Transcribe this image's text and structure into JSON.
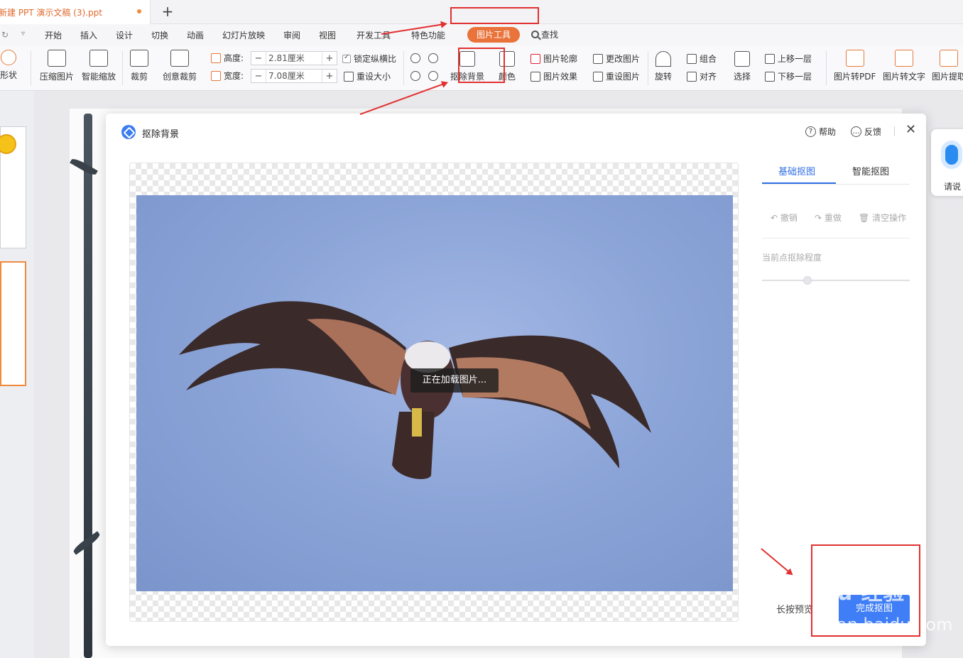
{
  "window": {
    "doc_tab_title": "新建 PPT 演示文稿 (3).ppt",
    "new_tab_symbol": "+"
  },
  "menubar": {
    "undo_symbol": "↻",
    "undo_more": "▿",
    "items": [
      "开始",
      "插入",
      "设计",
      "切换",
      "动画",
      "幻灯片放映",
      "审阅",
      "视图",
      "开发工具",
      "特色功能"
    ],
    "active_tab": "图片工具",
    "search_label": "查找"
  },
  "ribbon": {
    "shape_label": "形状",
    "compress_label": "压缩图片",
    "smart_zoom_label": "智能缩放",
    "crop_label": "裁剪",
    "creative_crop_label": "创意裁剪",
    "height_label": "高度:",
    "width_label": "宽度:",
    "height_value": "2.81厘米",
    "width_value": "7.08厘米",
    "lock_ratio_label": "锁定纵横比",
    "reset_size_label": "重设大小",
    "remove_bg_label": "抠除背景",
    "color_label": "颜色",
    "outline_label": "图片轮廓",
    "change_picture_label": "更改图片",
    "effects_label": "图片效果",
    "reset_picture_label": "重设图片",
    "rotate_label": "旋转",
    "group_label": "组合",
    "align_label": "对齐",
    "select_label": "选择",
    "bring_forward_label": "上移一层",
    "send_backward_label": "下移一层",
    "to_pdf_label": "图片转PDF",
    "to_text_label": "图片转文字",
    "extract_label": "图片提取"
  },
  "dialog": {
    "title": "抠除背景",
    "help_label": "帮助",
    "feedback_label": "反馈",
    "close_symbol": "✕",
    "loading_text": "正在加载图片...",
    "tabs": [
      "基础抠图",
      "智能抠图"
    ],
    "undo_label": "撤销",
    "redo_label": "重做",
    "clear_label": "清空操作",
    "degree_label": "当前点抠除程度",
    "degree_value": 0.3,
    "preview_label": "长按预览",
    "done_label": "完成抠图"
  },
  "voice": {
    "label": "请说"
  },
  "watermark": {
    "line1": "Baidu 经验",
    "line2": "jingyan.baidu.com"
  },
  "colors": {
    "accent_orange": "#e9733a",
    "primary_blue": "#3f7ef6",
    "annotation_red": "#e23030"
  }
}
